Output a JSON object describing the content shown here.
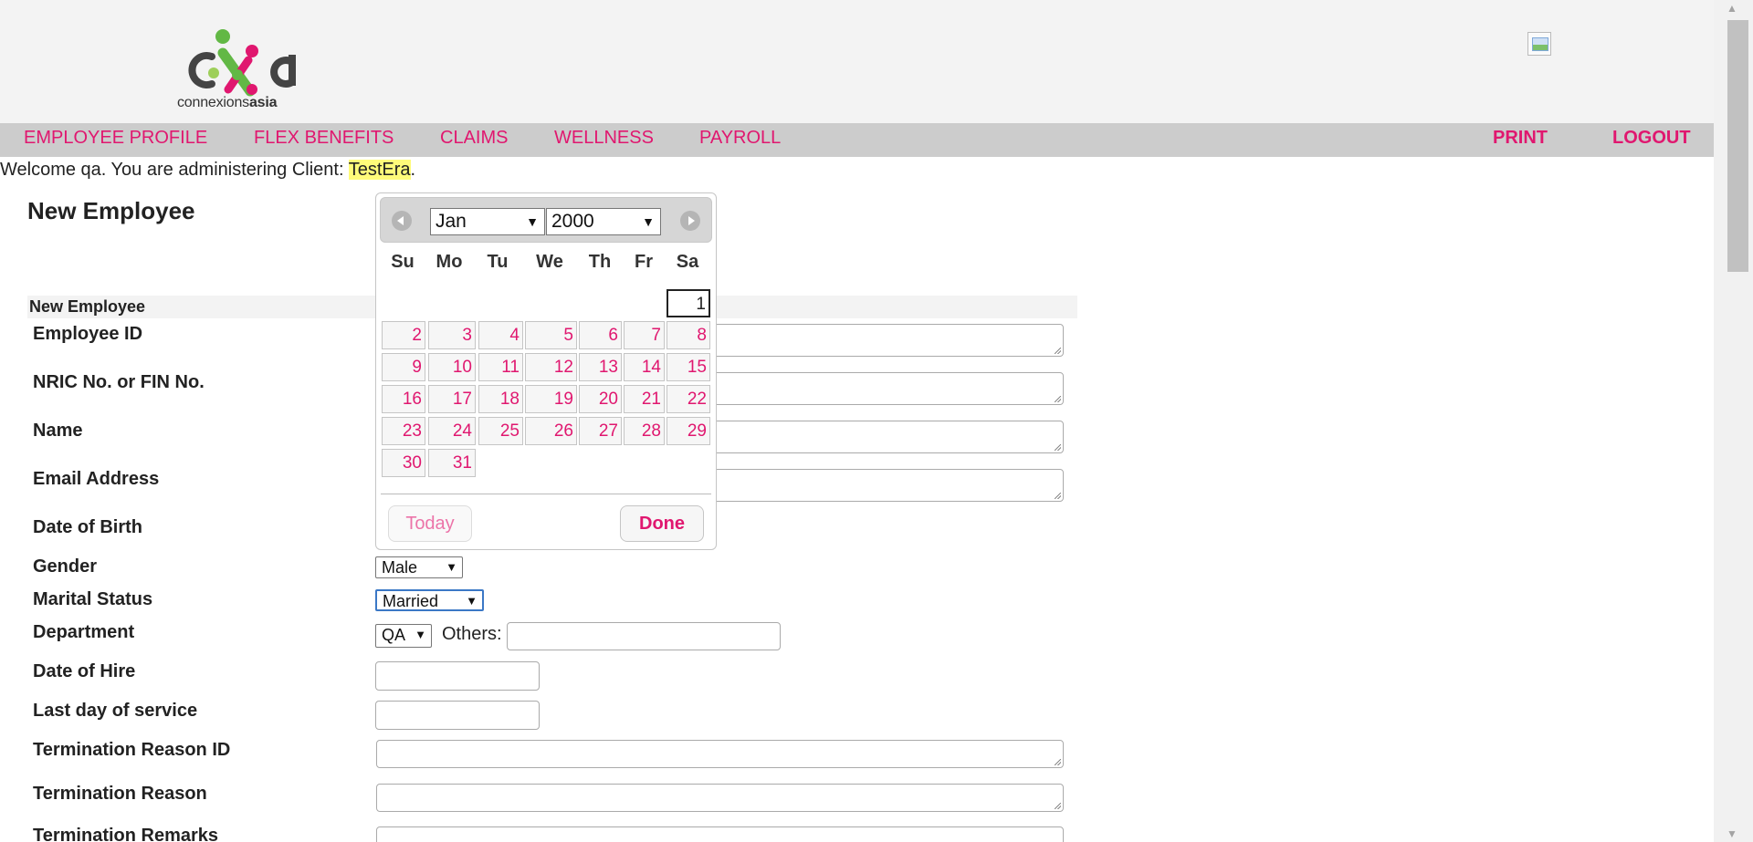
{
  "header": {
    "logo_alt": "connexionsasia",
    "logo_text_plain": "connexions",
    "logo_text_bold": "asia"
  },
  "nav": {
    "items": [
      "EMPLOYEE PROFILE",
      "FLEX BENEFITS",
      "CLAIMS",
      "WELLNESS",
      "PAYROLL"
    ],
    "print": "PRINT",
    "logout": "LOGOUT"
  },
  "welcome": {
    "prefix": "Welcome qa. You are administering Client: ",
    "client": "TestEra",
    "suffix": "."
  },
  "page_title": "New Employee",
  "section_title": "New Employee",
  "form": {
    "labels": {
      "employee_id": "Employee ID",
      "nric": "NRIC No. or FIN No.",
      "name": "Name",
      "email": "Email Address",
      "dob": "Date of Birth",
      "gender": "Gender",
      "marital": "Marital Status",
      "department": "Department",
      "date_of_hire": "Date of Hire",
      "last_day": "Last day of service",
      "term_reason_id": "Termination Reason ID",
      "term_reason": "Termination Reason",
      "term_remarks": "Termination Remarks"
    },
    "gender_value": "Male",
    "marital_value": "Married",
    "department_value": "QA",
    "others_label": "Others:"
  },
  "datepicker": {
    "month": "Jan",
    "year": "2000",
    "dow": [
      "Su",
      "Mo",
      "Tu",
      "We",
      "Th",
      "Fr",
      "Sa"
    ],
    "days": [
      "1",
      "2",
      "3",
      "4",
      "5",
      "6",
      "7",
      "8",
      "9",
      "10",
      "11",
      "12",
      "13",
      "14",
      "15",
      "16",
      "17",
      "18",
      "19",
      "20",
      "21",
      "22",
      "23",
      "24",
      "25",
      "26",
      "27",
      "28",
      "29",
      "30",
      "31"
    ],
    "today_label": "Today",
    "done_label": "Done"
  },
  "colors": {
    "accent": "#e0176f",
    "nav_bg": "#cccccc",
    "header_bg": "#f3f3f3",
    "highlight": "#fffb7a"
  }
}
